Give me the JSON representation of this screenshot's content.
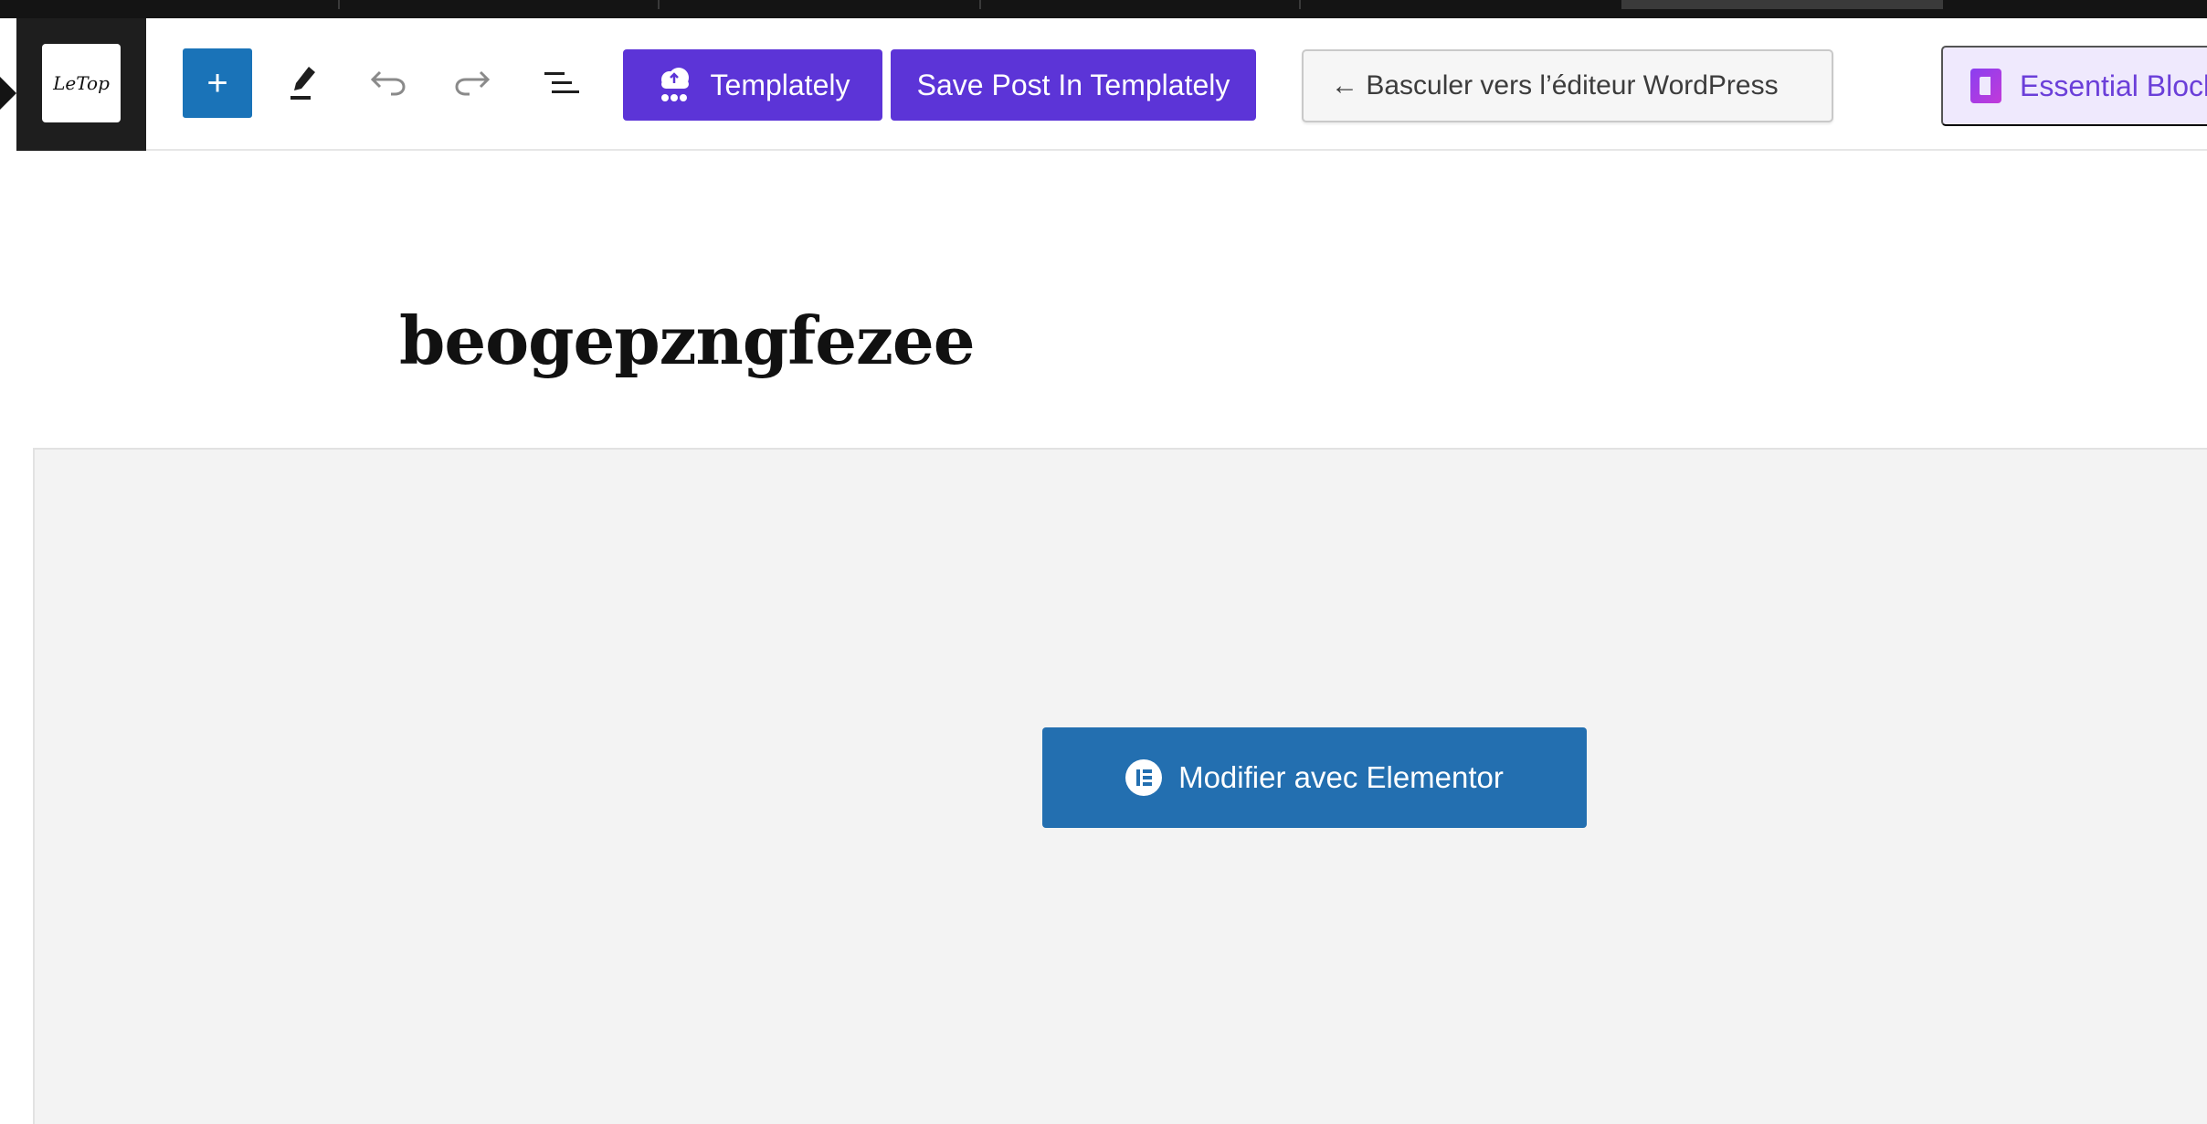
{
  "site": {
    "logo_text": "LeTop"
  },
  "toolbar": {
    "add_block_label": "+",
    "templately_label": "Templately",
    "save_templately_label": "Save Post In Templately",
    "switch_editor_label": "← Basculer vers l’éditeur WordPress",
    "essential_blocks_label": "Essential Blocks"
  },
  "icons": {
    "add": "plus-icon",
    "edit": "pencil-icon",
    "undo": "undo-icon",
    "redo": "redo-icon",
    "outline": "list-view-icon",
    "templately": "cloud-icon",
    "essential_blocks": "essential-blocks-logo-icon",
    "elementor": "elementor-icon"
  },
  "post": {
    "title": "beogepzngfezee"
  },
  "elementor": {
    "edit_label": "Modifier avec Elementor"
  },
  "colors": {
    "wp_blue": "#1a73b8",
    "templately_purple": "#5c34d7",
    "elementor_blue": "#236fb0",
    "essential_bg": "#efe9fd"
  }
}
